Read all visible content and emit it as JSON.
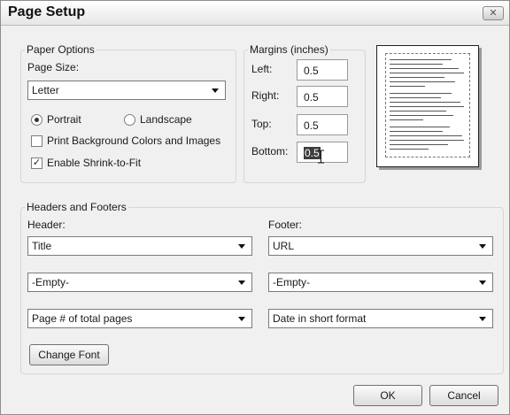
{
  "window": {
    "title": "Page Setup",
    "close_glyph": "✕"
  },
  "paper_options": {
    "legend": "Paper Options",
    "page_size_label": "Page Size:",
    "page_size_value": "Letter",
    "portrait_label": "Portrait",
    "landscape_label": "Landscape",
    "orientation_selected": "Portrait",
    "print_bg_label": "Print Background Colors and Images",
    "print_bg_checked": false,
    "shrink_label": "Enable Shrink-to-Fit",
    "shrink_checked": true,
    "check_glyph": "✓"
  },
  "margins": {
    "legend": "Margins (inches)",
    "left_label": "Left:",
    "left_value": "0.5",
    "right_label": "Right:",
    "right_value": "0.5",
    "top_label": "Top:",
    "top_value": "0.5",
    "bottom_label": "Bottom:",
    "bottom_value": "0.5"
  },
  "headers_footers": {
    "legend": "Headers and Footers",
    "header_label": "Header:",
    "footer_label": "Footer:",
    "header_1": "Title",
    "header_2": "-Empty-",
    "header_3": "Page # of total pages",
    "footer_1": "URL",
    "footer_2": "-Empty-",
    "footer_3": "Date in short format",
    "change_font_label": "Change Font"
  },
  "buttons": {
    "ok": "OK",
    "cancel": "Cancel"
  },
  "icons": {
    "close": "close-icon",
    "dropdown": "chevron-down-icon",
    "text_cursor": "ibeam-cursor-icon"
  }
}
